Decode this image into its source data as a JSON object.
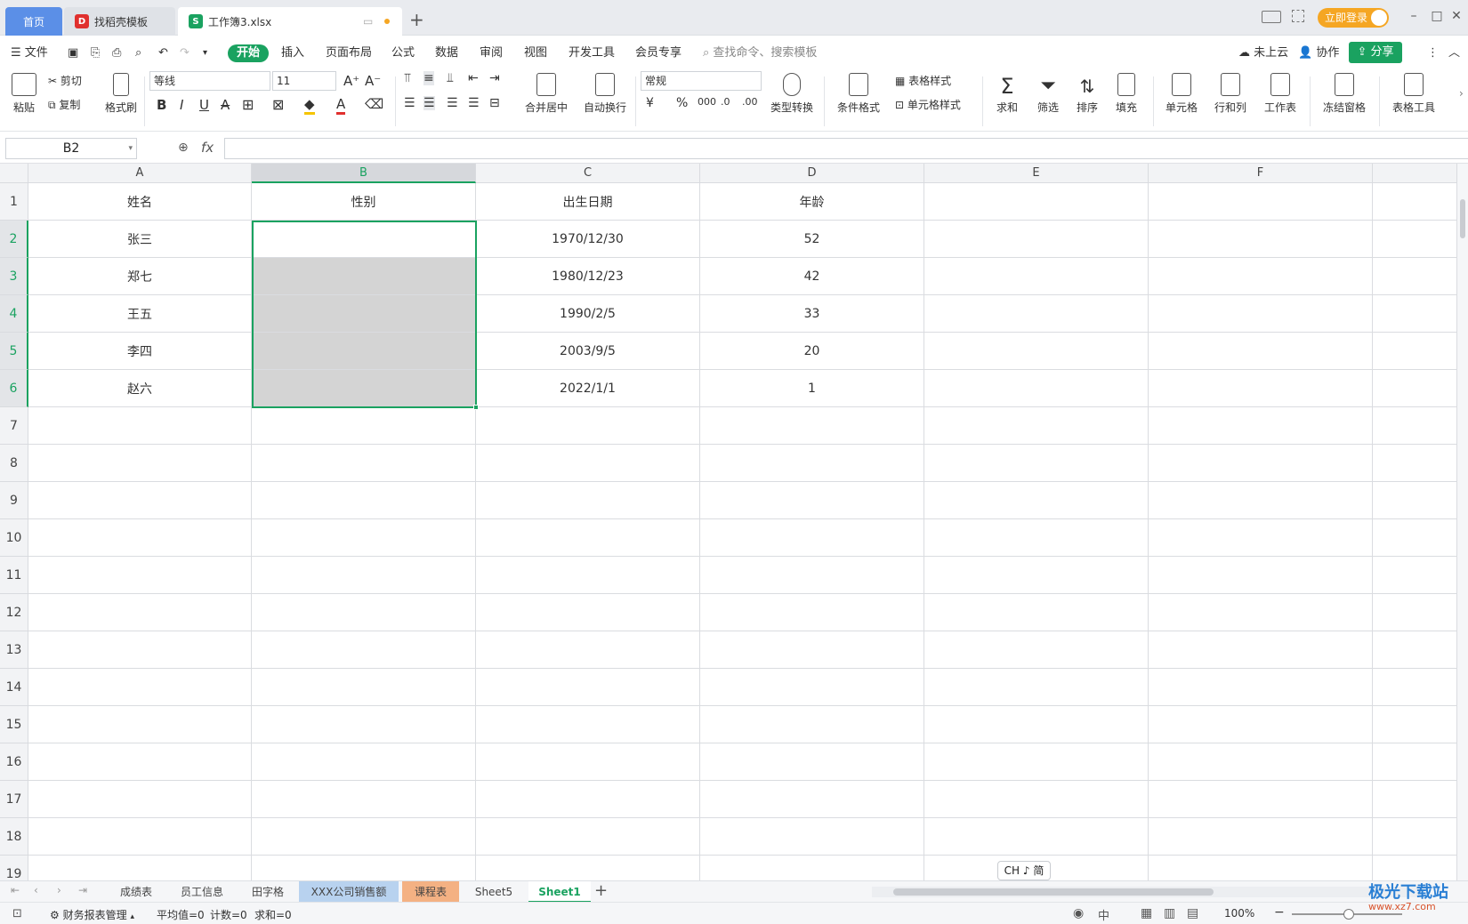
{
  "tabs": {
    "home": "首页",
    "template": "找稻壳模板",
    "file": "工作簿3.xlsx"
  },
  "titlebar": {
    "login": "立即登录"
  },
  "menu": {
    "file": "文件",
    "start": "开始",
    "insert": "插入",
    "layout": "页面布局",
    "formula": "公式",
    "data": "数据",
    "review": "审阅",
    "view": "视图",
    "dev": "开发工具",
    "member": "会员专享",
    "search": "查找命令、搜索模板",
    "cloud": "未上云",
    "collab": "协作",
    "share": "分享"
  },
  "ribbon": {
    "paste": "粘贴",
    "cut": "剪切",
    "copy": "复制",
    "format_painter": "格式刷",
    "font_name": "等线",
    "font_size": "11",
    "merge": "合并居中",
    "wrap": "自动换行",
    "number_format": "常规",
    "type_convert": "类型转换",
    "cond_format": "条件格式",
    "table_style": "表格样式",
    "cell_style": "单元格样式",
    "sum": "求和",
    "filter": "筛选",
    "sort": "排序",
    "fill": "填充",
    "cell": "单元格",
    "row_col": "行和列",
    "worksheet": "工作表",
    "freeze": "冻结窗格",
    "table_tools": "表格工具"
  },
  "formula_bar": {
    "name_box": "B2",
    "fx": "fx",
    "value": ""
  },
  "columns": [
    "A",
    "B",
    "C",
    "D",
    "E",
    "F"
  ],
  "rows": [
    "1",
    "2",
    "3",
    "4",
    "5",
    "6",
    "7",
    "8",
    "9",
    "10",
    "11",
    "12",
    "13",
    "14",
    "15",
    "16",
    "17",
    "18",
    "19"
  ],
  "table": [
    [
      "姓名",
      "性别",
      "出生日期",
      "年龄"
    ],
    [
      "张三",
      "",
      "1970/12/30",
      "52"
    ],
    [
      "郑七",
      "",
      "1980/12/23",
      "42"
    ],
    [
      "王五",
      "",
      "1990/2/5",
      "33"
    ],
    [
      "李四",
      "",
      "2003/9/5",
      "20"
    ],
    [
      "赵六",
      "",
      "2022/1/1",
      "1"
    ]
  ],
  "ime": "CH ♪ 简",
  "sheets": [
    "成绩表",
    "员工信息",
    "田字格",
    "XXX公司销售额",
    "课程表",
    "Sheet5",
    "Sheet1"
  ],
  "status": {
    "macro": "财务报表管理",
    "average": "平均值=0",
    "count": "计数=0",
    "sum": "求和=0",
    "zoom": "100%"
  },
  "watermark": {
    "site": "极光下载站",
    "url": "www.xz7.com"
  },
  "colors": {
    "accent": "#1aa260",
    "selection": "#d4d4d4",
    "home_tab": "#5b8fe7",
    "login": "#f5a623"
  }
}
